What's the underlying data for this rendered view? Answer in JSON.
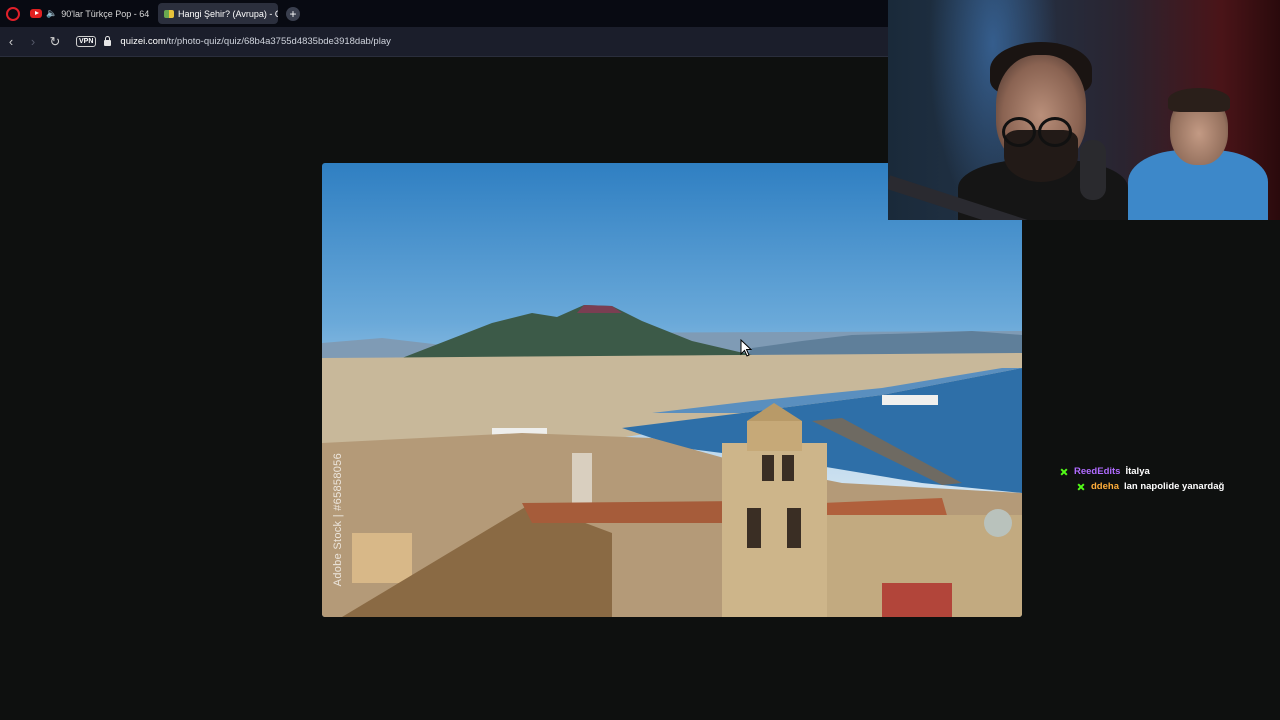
{
  "browser": {
    "tabs": [
      {
        "title": "90'lar Türkçe Pop - 64",
        "icon": "youtube-icon",
        "audio": "speaker-icon"
      },
      {
        "title": "Hangi Şehir? (Avrupa) - Q",
        "icon": "flag-icon",
        "active": true
      }
    ],
    "new_tab_label": "+",
    "vpn_label": "VPN",
    "url_domain": "quizei.com",
    "url_path": "/tr/photo-quiz/quiz/68b4a3755d4835bde3918dab/play"
  },
  "quiz": {
    "photo_watermark": "Adobe Stock | #65858056"
  },
  "chat": {
    "messages": [
      {
        "user": "ReedEdits",
        "user_color": "#b06bff",
        "text": "İtalya"
      },
      {
        "user": "ddeha",
        "user_color": "#ffae3b",
        "text": "lan napolide yanardağ"
      }
    ]
  },
  "colors": {
    "accent_badge": "#53fc18",
    "active_tab": "#2b2f3d"
  }
}
